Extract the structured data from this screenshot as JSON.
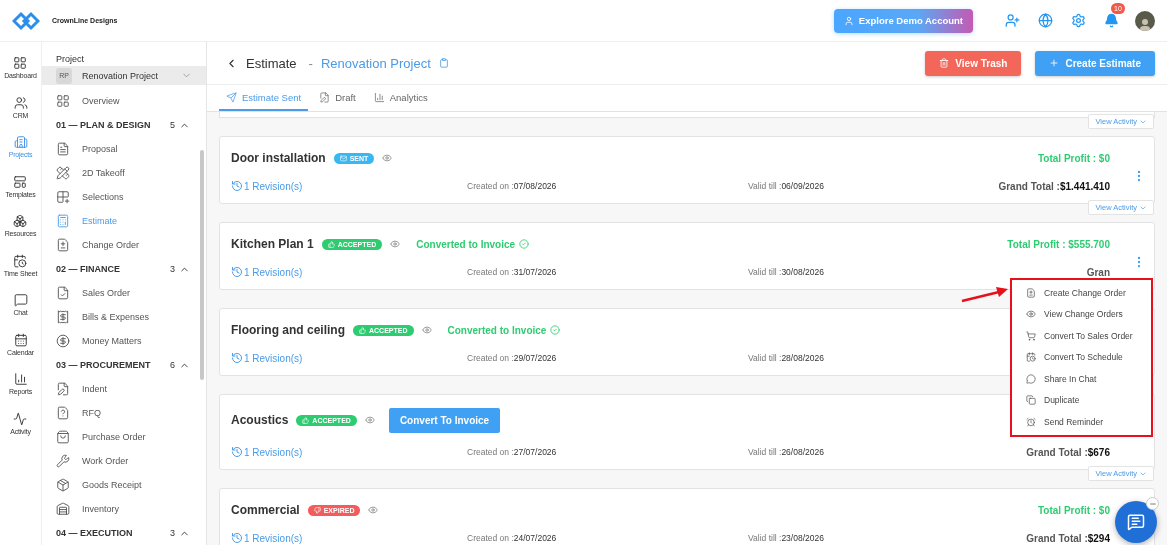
{
  "brand": {
    "name": "CrownLine Designs"
  },
  "topbar": {
    "demo_button": "Explore Demo Account",
    "notifications": "10"
  },
  "rail": [
    {
      "label": "Dashboard",
      "selected": false
    },
    {
      "label": "CRM",
      "selected": false
    },
    {
      "label": "Projects",
      "selected": true
    },
    {
      "label": "Templates",
      "selected": false
    },
    {
      "label": "Resources",
      "selected": false
    },
    {
      "label": "Time Sheet",
      "selected": false
    },
    {
      "label": "Chat",
      "selected": false
    },
    {
      "label": "Calendar",
      "selected": false
    },
    {
      "label": "Reports",
      "selected": false
    },
    {
      "label": "Activity",
      "selected": false
    }
  ],
  "project_nav": {
    "heading": "Project",
    "project": {
      "initials": "RP",
      "name": "Renovation Project"
    },
    "overview": {
      "label": "Overview",
      "selected": false
    },
    "sections": [
      {
        "title": "01 — PLAN & DESIGN",
        "count": "5",
        "expanded": true,
        "items": [
          {
            "label": "Proposal",
            "selected": false
          },
          {
            "label": "2D Takeoff",
            "selected": false
          },
          {
            "label": "Selections",
            "selected": false
          },
          {
            "label": "Estimate",
            "selected": true
          },
          {
            "label": "Change Order",
            "selected": false
          }
        ]
      },
      {
        "title": "02 — FINANCE",
        "count": "3",
        "expanded": true,
        "items": [
          {
            "label": "Sales Order",
            "selected": false
          },
          {
            "label": "Bills & Expenses",
            "selected": false
          },
          {
            "label": "Money Matters",
            "selected": false
          }
        ]
      },
      {
        "title": "03 — PROCUREMENT",
        "count": "6",
        "expanded": true,
        "items": [
          {
            "label": "Indent",
            "selected": false
          },
          {
            "label": "RFQ",
            "selected": false
          },
          {
            "label": "Purchase Order",
            "selected": false
          },
          {
            "label": "Work Order",
            "selected": false
          },
          {
            "label": "Goods Receipt",
            "selected": false
          },
          {
            "label": "Inventory",
            "selected": false
          }
        ]
      },
      {
        "title": "04 — EXECUTION",
        "count": "3",
        "expanded": true
      }
    ]
  },
  "header": {
    "title": "Estimate",
    "separator": "-",
    "project": "Renovation Project",
    "buttons": [
      {
        "label": "View Trash",
        "kind": "danger"
      },
      {
        "label": "Create Estimate",
        "kind": "primary"
      }
    ]
  },
  "tabs": [
    {
      "label": "Estimate Sent",
      "selected": true
    },
    {
      "label": "Draft",
      "selected": false
    },
    {
      "label": "Analytics",
      "selected": false
    }
  ],
  "top_activity_link": "View Activity",
  "estimates": [
    {
      "name": "Door installation",
      "status": {
        "kind": "sent",
        "label": "SENT"
      },
      "profit": "Total Profit : $0",
      "kebab": true,
      "revisions": "1 Revision(s)",
      "created_label": "Created on :",
      "created": "07/08/2026",
      "valid_label": "Valid till :",
      "valid": "06/09/2026",
      "grand_label": "Grand Total :",
      "grand": "$1.441.410",
      "activity_link": "View Activity"
    },
    {
      "name": "Kitchen Plan 1",
      "status": {
        "kind": "accepted",
        "label": "ACCEPTED"
      },
      "invoice": {
        "kind": "converted",
        "label": "Converted to Invoice"
      },
      "profit": "Total Profit : $555.700",
      "kebab": true,
      "revisions": "1 Revision(s)",
      "created_label": "Created on :",
      "created": "31/07/2026",
      "valid_label": "Valid till :",
      "valid": "30/08/2026",
      "grand_label": "Gran"
    },
    {
      "name": "Flooring and ceiling",
      "status": {
        "kind": "accepted",
        "label": "ACCEPTED"
      },
      "invoice": {
        "kind": "converted",
        "label": "Converted to Invoice"
      },
      "kebab": false,
      "revisions": "1 Revision(s)",
      "created_label": "Created on :",
      "created": "29/07/2026",
      "valid_label": "Valid till :",
      "valid": "28/08/2026"
    },
    {
      "name": "Acoustics",
      "status": {
        "kind": "accepted",
        "label": "ACCEPTED"
      },
      "invoice": {
        "kind": "button",
        "label": "Convert To Invoice"
      },
      "kebab": false,
      "revisions": "1 Revision(s)",
      "created_label": "Created on :",
      "created": "27/07/2026",
      "valid_label": "Valid till :",
      "valid": "26/08/2026",
      "grand_label": "Grand Total :",
      "grand": "$676",
      "activity_link": "View Activity"
    },
    {
      "name": "Commercial",
      "status": {
        "kind": "expired",
        "label": "EXPIRED"
      },
      "profit": "Total Profit : $0",
      "kebab": false,
      "revisions": "1 Revision(s)",
      "created_label": "Created on :",
      "created": "24/07/2026",
      "valid_label": "Valid till :",
      "valid": "23/08/2026",
      "grand_label": "Grand Total :",
      "grand": "$294"
    }
  ],
  "context_menu": [
    {
      "label": "Create Change Order"
    },
    {
      "label": "View Change Orders"
    },
    {
      "label": "Convert To Sales Order"
    },
    {
      "label": "Convert To Schedule"
    },
    {
      "label": "Share In Chat"
    },
    {
      "label": "Duplicate"
    },
    {
      "label": "Send Reminder"
    }
  ]
}
